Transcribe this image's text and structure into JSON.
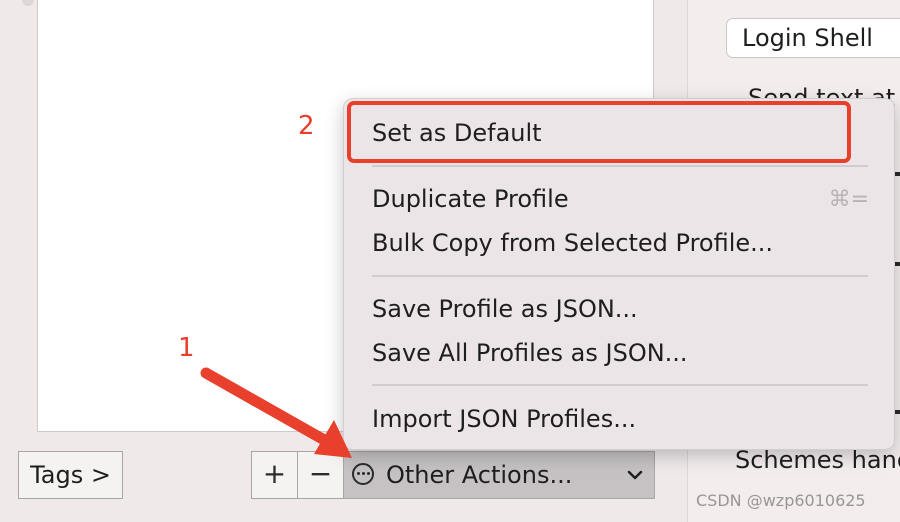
{
  "right_panel": {
    "login_shell": "Login Shell",
    "send_text": "Send text at",
    "schemes_text": "Schemes hand"
  },
  "bottom_bar": {
    "tags_label": "Tags >",
    "add_label": "+",
    "remove_label": "−",
    "other_actions_label": "Other Actions..."
  },
  "menu": {
    "items": [
      "Set as Default",
      "Duplicate Profile",
      "Bulk Copy from Selected Profile...",
      "Save Profile as JSON...",
      "Save All Profiles as JSON...",
      "Import JSON Profiles..."
    ],
    "duplicate_shortcut": "⌘="
  },
  "annotations": {
    "step1": "1",
    "step2": "2",
    "highlight_color": "#e8402c"
  },
  "watermark": "CSDN @wzp6010625",
  "icons": {
    "more": "ellipsis-circle-icon",
    "chevron": "chevron-down-icon"
  }
}
